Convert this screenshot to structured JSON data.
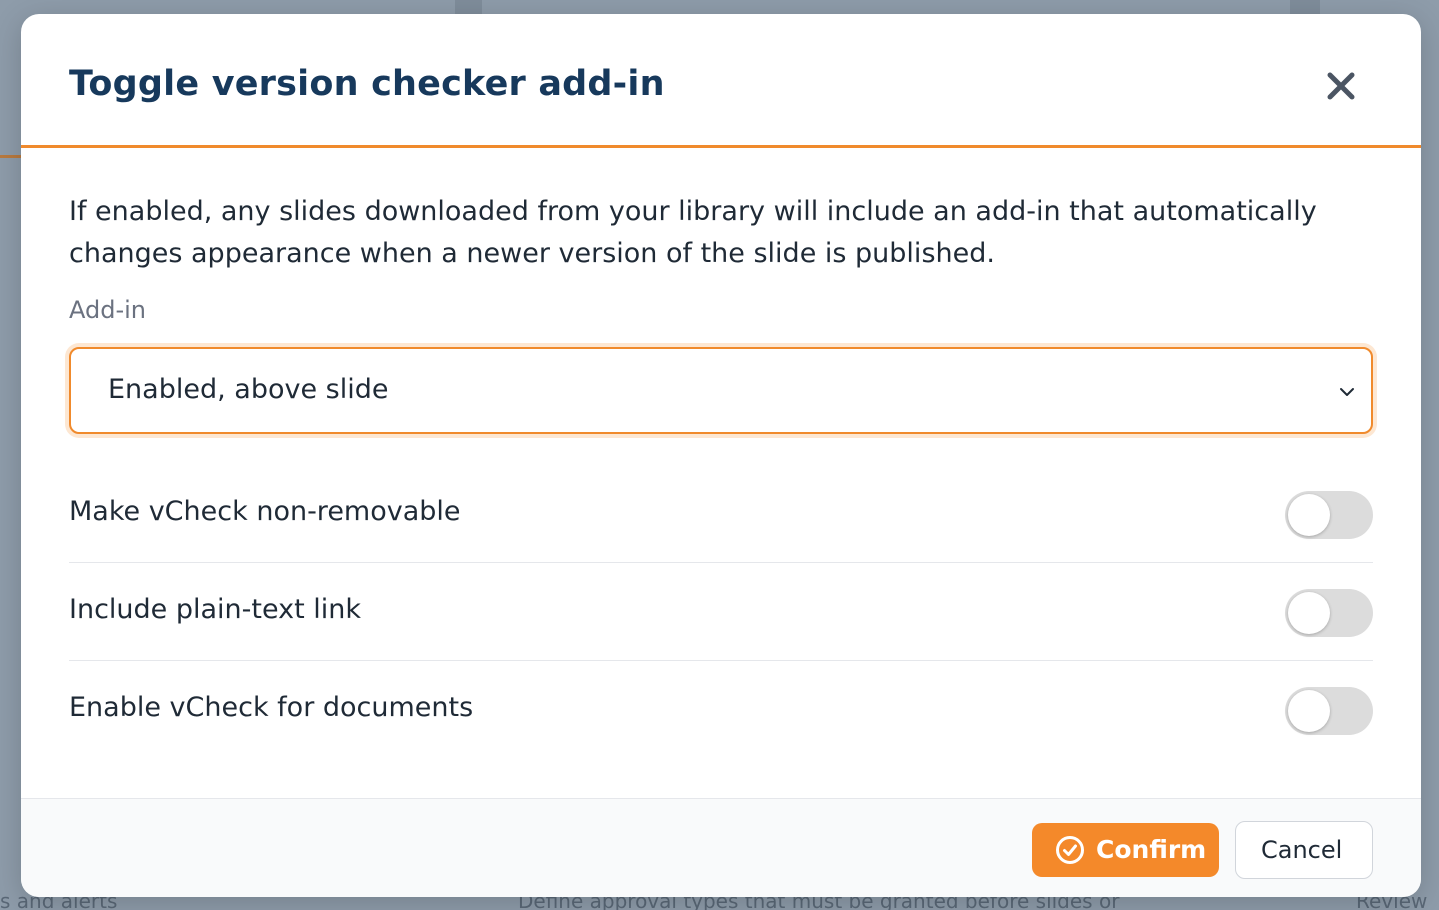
{
  "dialog": {
    "title": "Toggle version checker add-in",
    "description": "If enabled, any slides downloaded from your library will include an add-in that automatically changes appearance when a newer version of the slide is published.",
    "addin_label": "Add-in",
    "addin_selected": "Enabled, above slide",
    "toggles": [
      {
        "label": "Make vCheck non-removable",
        "enabled": false
      },
      {
        "label": "Include plain-text link",
        "enabled": false
      },
      {
        "label": "Enable vCheck for documents",
        "enabled": false
      }
    ],
    "confirm_label": "Confirm",
    "cancel_label": "Cancel"
  },
  "background": {
    "left_snippet": "s and alerts",
    "center_snippet": "Define approval types that must be granted before slides or",
    "right_snippet": "Review"
  },
  "colors": {
    "accent": "#f08a2c",
    "title": "#17395c",
    "toggle_off": "#dcdcdc"
  },
  "icons": {
    "close": "close-icon",
    "chevron": "chevron-down-icon",
    "confirm": "check-circle-icon"
  }
}
